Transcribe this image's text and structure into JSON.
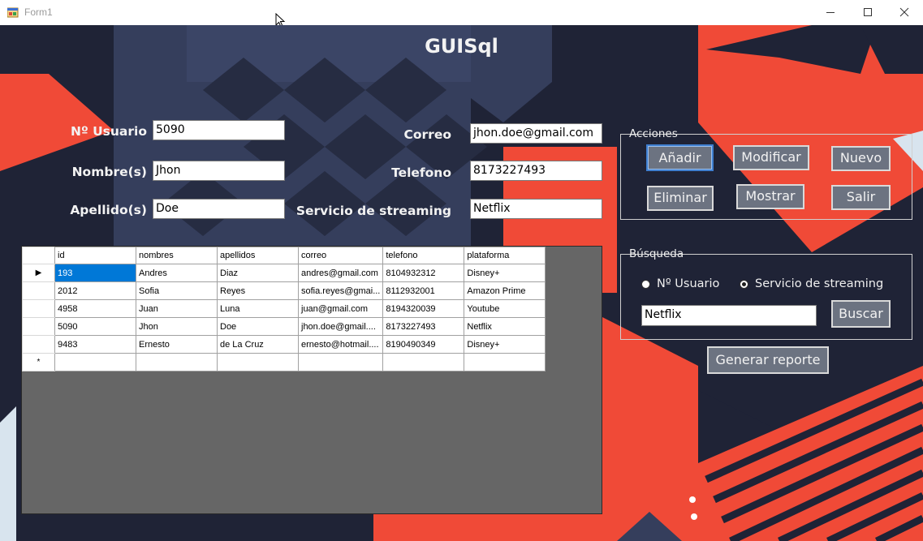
{
  "window": {
    "title": "Form1"
  },
  "app": {
    "title": "GUISql"
  },
  "form": {
    "usuario": {
      "label": "Nº Usuario",
      "value": "5090"
    },
    "nombre": {
      "label": "Nombre(s)",
      "value": "Jhon"
    },
    "apellido": {
      "label": "Apellido(s)",
      "value": "Doe"
    },
    "correo": {
      "label": "Correo",
      "value": "jhon.doe@gmail.com"
    },
    "telefono": {
      "label": "Telefono",
      "value": "8173227493"
    },
    "servicio": {
      "label": "Servicio de streaming",
      "value": "Netflix"
    }
  },
  "acciones": {
    "legend": "Acciones",
    "anadir": "Añadir",
    "modificar": "Modificar",
    "nuevo": "Nuevo",
    "eliminar": "Eliminar",
    "mostrar": "Mostrar",
    "salir": "Salir"
  },
  "busqueda": {
    "legend": "Búsqueda",
    "radio_usuario": "Nº Usuario",
    "radio_servicio": "Servicio de streaming",
    "selected": "Servicio de streaming",
    "query": "Netflix",
    "buscar": "Buscar"
  },
  "reporte": {
    "label": "Generar reporte"
  },
  "grid": {
    "columns": [
      "id",
      "nombres",
      "apellidos",
      "correo",
      "telefono",
      "plataforma"
    ],
    "rows": [
      [
        "193",
        "Andres",
        "Diaz",
        "andres@gmail.com",
        "8104932312",
        "Disney+"
      ],
      [
        "2012",
        "Sofia",
        "Reyes",
        "sofia.reyes@gmai...",
        "8112932001",
        "Amazon Prime"
      ],
      [
        "4958",
        "Juan",
        "Luna",
        "juan@gmail.com",
        "8194320039",
        "Youtube"
      ],
      [
        "5090",
        "Jhon",
        "Doe",
        "jhon.doe@gmail....",
        "8173227493",
        "Netflix"
      ],
      [
        "9483",
        "Ernesto",
        "de La Cruz",
        "ernesto@hotmail....",
        "8190490349",
        "Disney+"
      ]
    ],
    "current_row_marker": "▶",
    "new_row_marker": "*"
  },
  "icons": {
    "app": "form-app-icon",
    "minimize": "minimize-icon",
    "maximize": "maximize-icon",
    "close": "close-icon",
    "cursor": "mouse-cursor-icon"
  },
  "colors": {
    "background_dark": "#1f2336",
    "background_navy": "#353e5c",
    "accent_red": "#f04a37",
    "accent_light": "#d8e4ee",
    "button": "#6c7381",
    "selection": "#0078d7"
  }
}
